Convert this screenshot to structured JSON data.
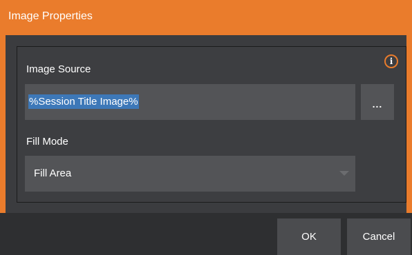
{
  "dialog": {
    "title": "Image Properties"
  },
  "image_source": {
    "label": "Image Source",
    "value": "%Session Title Image%",
    "browse_label": "..."
  },
  "fill_mode": {
    "label": "Fill Mode",
    "selected": "Fill Area"
  },
  "info": {
    "icon_glyph": "i",
    "icon": "info-icon"
  },
  "footer": {
    "ok_label": "OK",
    "cancel_label": "Cancel"
  },
  "colors": {
    "accent": "#ea7c2c",
    "panel": "#3b3c3f",
    "field": "#535457",
    "selection": "#3d78b8",
    "button": "#4b4c4f"
  }
}
